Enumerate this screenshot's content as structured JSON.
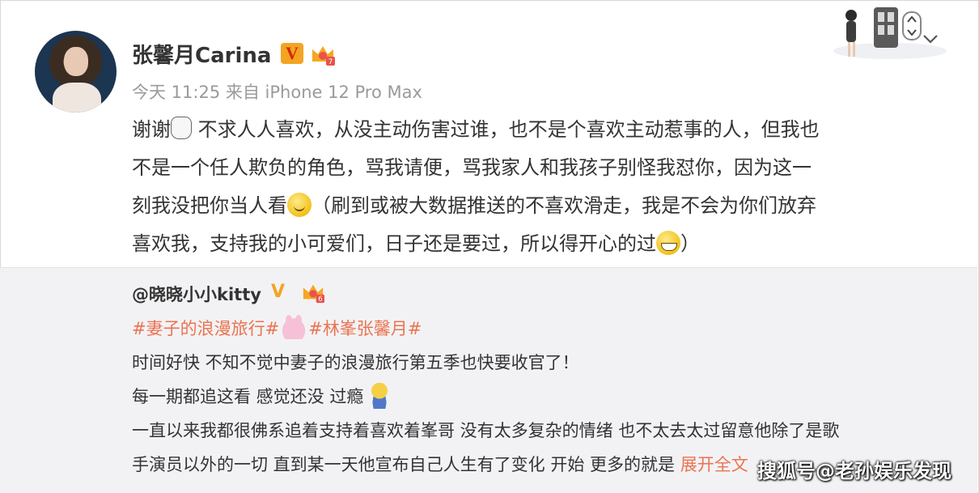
{
  "post": {
    "username": "张馨月Carina",
    "verified_badge": "V",
    "level_badge": "7",
    "timestamp": "今天 11:25 来自 iPhone 12 Pro Max",
    "lines": [
      [
        "谢谢",
        "不求人人喜欢，从没主动伤害过谁，也不是个喜欢主动惹事的人，但我也"
      ],
      [
        "不是一个任人欺负的角色，骂我请便，骂我家人和我孩子别怪我怼你，因为这一"
      ],
      [
        "刻我没把你当人看",
        "（刷到或被大数据推送的不喜欢滑走，我是不会为你们放弃"
      ],
      [
        "喜欢我，支持我的小可爱们，日子还是要过，所以得开心的过",
        "）"
      ]
    ]
  },
  "repost": {
    "username": "@晓晓小小kitty",
    "verified_badge": "V",
    "level_badge": "6",
    "tag1": "#妻子的浪漫旅行#",
    "tag2": "#林峯张馨月#",
    "line2": "时间好快 不知不觉中妻子的浪漫旅行第五季也快要收官了！",
    "line3_a": "每一期都追这看 感觉还没",
    "line3_b": " 过瘾",
    "line4": "一直以来我都很佛系追着支持着喜欢着峯哥 没有太多复杂的情绪 也不太去太过留意他除了是歌",
    "line5": "手演员以外的一切 直到某一天他宣布自己人生有了变化 开始 更多的就是 ",
    "expand": "展开全文"
  },
  "watermark": "搜狐号@老孙娱乐发现",
  "icons": {
    "emoji_1": "shy-cry-emoji-icon",
    "emoji_2": "smile-emoji-icon",
    "emoji_3": "grin-emoji-icon",
    "emoji_4": "bunny-emoji-icon",
    "emoji_5": "duck-emoji-icon",
    "menu": "chevron-down-icon"
  },
  "colors": {
    "tag": "#eb7350",
    "badge_orange": "#f3a422",
    "meta_gray": "#9a9a9a",
    "repost_bg": "#f2f2f5"
  }
}
